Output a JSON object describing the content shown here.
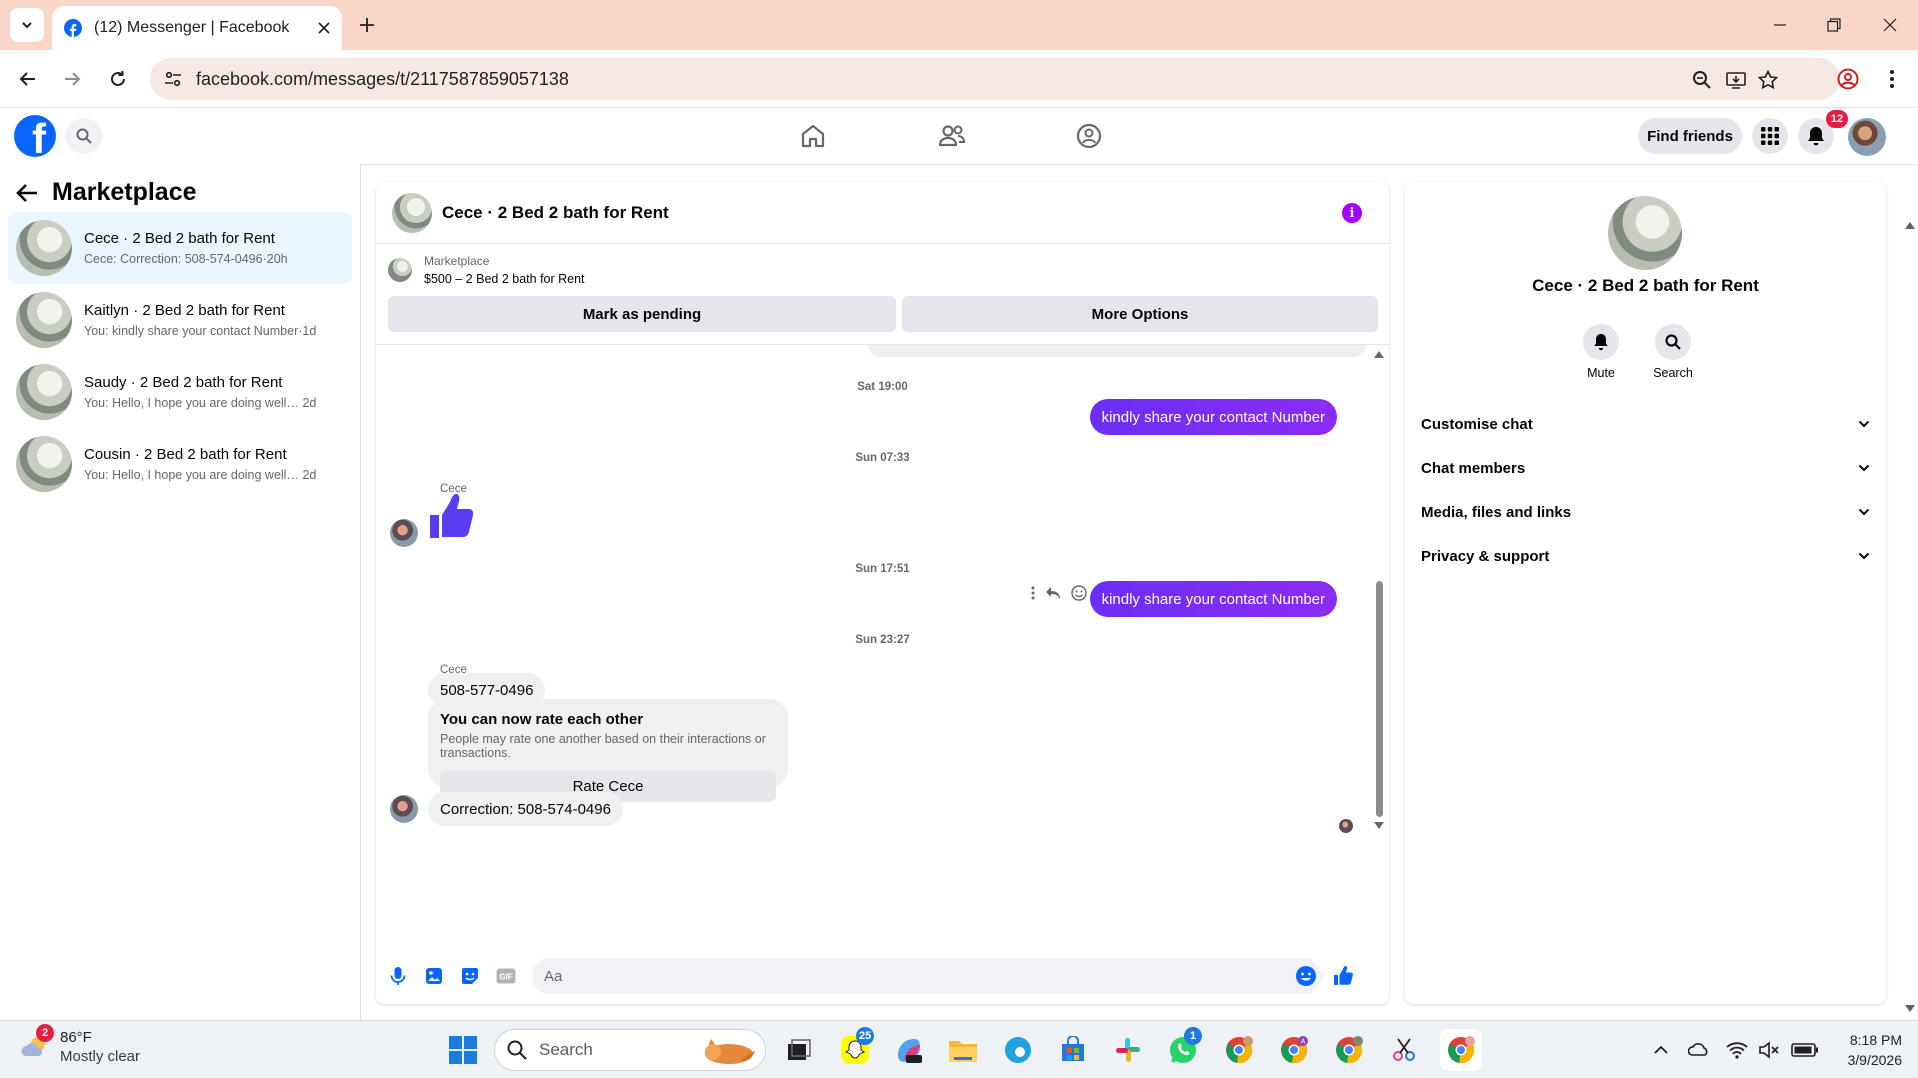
{
  "browser": {
    "tab_title": "(12) Messenger | Facebook",
    "url": "facebook.com/messages/t/2117587859057138"
  },
  "fb_header": {
    "find_friends_label": "Find friends",
    "notification_count": "12"
  },
  "sidebar": {
    "title": "Marketplace",
    "conversations": [
      {
        "name": "Cece · 2 Bed 2 bath for Rent",
        "preview": "Cece: Correction: 508-574-0496",
        "time": "20h",
        "active": true
      },
      {
        "name": "Kaitlyn · 2 Bed 2 bath for Rent",
        "preview": "You: kindly share your contact Number",
        "time": "1d",
        "active": false
      },
      {
        "name": "Saudy · 2 Bed 2 bath for Rent",
        "preview": "You: Hello, I hope you are doing well. ...",
        "time": "2d",
        "active": false
      },
      {
        "name": "Cousin · 2 Bed 2 bath for Rent",
        "preview": "You: Hello, I hope you are doing well. ...",
        "time": "2d",
        "active": false
      }
    ]
  },
  "chat": {
    "title": "Cece · 2 Bed 2 bath for Rent",
    "listing_label": "Marketplace",
    "listing_title": "$500 – 2 Bed 2 bath for Rent",
    "mark_pending_label": "Mark as pending",
    "more_options_label": "More Options",
    "timestamps": [
      "Sat 19:00",
      "Sun 07:33",
      "Sun 17:51",
      "Sun 23:27"
    ],
    "outgoing_1": "kindly share your contact Number",
    "outgoing_2": "kindly share your contact Number",
    "sender_name": "Cece",
    "incoming_phone": "508-577-0496",
    "rating_title": "You can now rate each other",
    "rating_desc": "People may rate one another based on their interactions or transactions.",
    "rate_button": "Rate Cece",
    "incoming_correction": "Correction: 508-574-0496",
    "input_placeholder": "Aa"
  },
  "info_panel": {
    "name": "Cece · 2 Bed 2 bath for Rent",
    "mute_label": "Mute",
    "search_label": "Search",
    "sections": [
      "Customise chat",
      "Chat members",
      "Media, files and links",
      "Privacy & support"
    ]
  },
  "taskbar": {
    "weather_badge": "2",
    "temperature": "86°F",
    "condition": "Mostly clear",
    "search_text": "Search",
    "snapchat_badge": "25",
    "whatsapp_badge": "1",
    "time": "8:18 PM",
    "date": "3/9/2026"
  },
  "colors": {
    "facebook_blue": "#0866ff",
    "message_purple": "#7a2ff7",
    "info_purple": "#a400ff",
    "notif_red": "#e41e3f"
  }
}
